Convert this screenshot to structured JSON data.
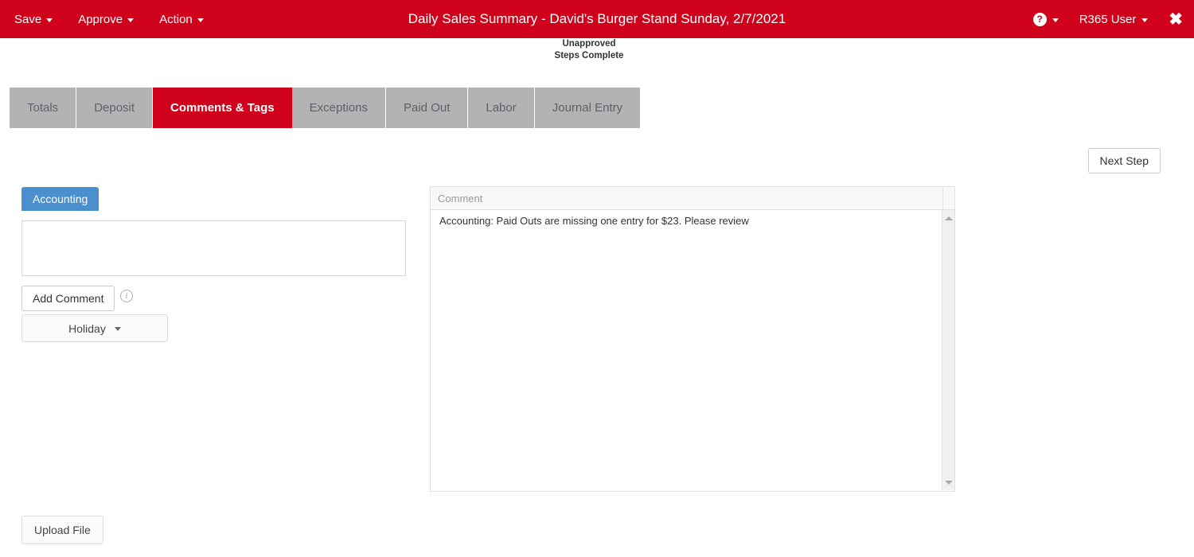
{
  "header": {
    "title": "Daily Sales Summary - David's Burger Stand Sunday, 2/7/2021",
    "menu": [
      {
        "label": "Save"
      },
      {
        "label": "Approve"
      },
      {
        "label": "Action"
      }
    ],
    "help_icon": "question-mark-icon",
    "help_glyph": "?",
    "user_label": "R365 User",
    "close_glyph": "✖",
    "brand_red": "#d0021b"
  },
  "status": {
    "line1": "Unapproved",
    "line2": "Steps Complete"
  },
  "tabs": [
    {
      "label": "Totals",
      "active": false
    },
    {
      "label": "Deposit",
      "active": false
    },
    {
      "label": "Comments & Tags",
      "active": true
    },
    {
      "label": "Exceptions",
      "active": false
    },
    {
      "label": "Paid Out",
      "active": false
    },
    {
      "label": "Labor",
      "active": false
    },
    {
      "label": "Journal Entry",
      "active": false
    }
  ],
  "actions": {
    "next_step_label": "Next Step",
    "upload_file_label": "Upload File"
  },
  "comment_form": {
    "account_tab_label": "Accounting",
    "account_tab_color": "#4a8fce",
    "input_value": "",
    "input_placeholder": "",
    "add_comment_label": "Add Comment",
    "info_icon": "info-circle-icon",
    "info_glyph": "i",
    "tag_dropdown_value": "Holiday"
  },
  "comment_grid": {
    "column_header": "Comment",
    "rows": [
      {
        "comment": "Accounting: Paid Outs are missing one entry for $23. Please review"
      }
    ]
  }
}
